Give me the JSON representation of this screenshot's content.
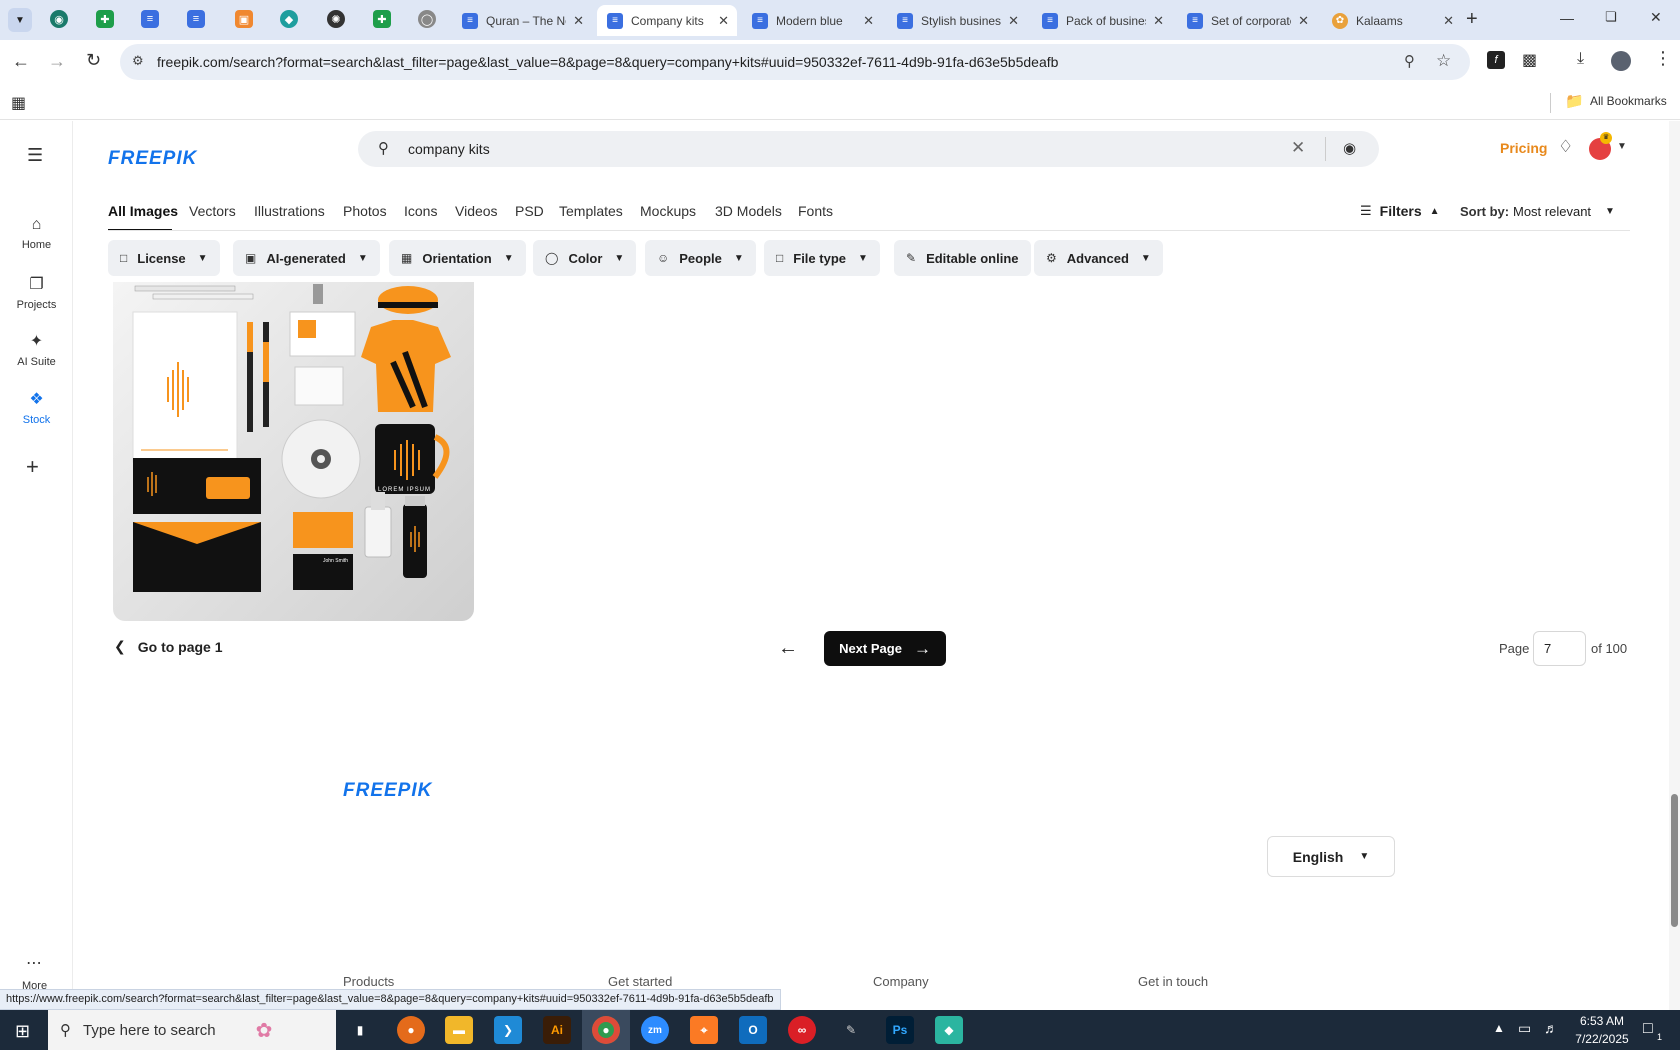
{
  "browser": {
    "tabs": [
      {
        "title": "Quran – The Noble",
        "active": false
      },
      {
        "title": "Company kits",
        "active": true
      },
      {
        "title": "Modern blue",
        "active": false
      },
      {
        "title": "Stylish business",
        "active": false
      },
      {
        "title": "Pack of business",
        "active": false
      },
      {
        "title": "Set of corporate",
        "active": false
      },
      {
        "title": "Kalaams",
        "active": false
      }
    ],
    "url": "freepik.com/search?format=search&last_filter=page&last_value=8&page=8&query=company+kits#uuid=950332ef-7611-4d9b-91fa-d63e5b5deafb",
    "bookmarks_label": "All Bookmarks",
    "status_url": "https://www.freepik.com/search?format=search&last_filter=page&last_value=8&page=8&query=company+kits#uuid=950332ef-7611-4d9b-91fa-d63e5b5deafb"
  },
  "rail": {
    "items": [
      {
        "label": "Home",
        "icon": "home-icon"
      },
      {
        "label": "Projects",
        "icon": "folder-icon"
      },
      {
        "label": "AI Suite",
        "icon": "sparkle-icon"
      },
      {
        "label": "Stock",
        "icon": "stock-icon"
      }
    ],
    "more": "More"
  },
  "header": {
    "logo": "FREEPIK",
    "search_value": "company kits",
    "pricing": "Pricing"
  },
  "nav": {
    "tabs": [
      "All Images",
      "Vectors",
      "Illustrations",
      "Photos",
      "Icons",
      "Videos",
      "PSD",
      "Templates",
      "Mockups",
      "3D Models",
      "Fonts"
    ],
    "filters": "Filters",
    "sort_label": "Sort by:",
    "sort_value": "Most relevant"
  },
  "chips": [
    "License",
    "AI-generated",
    "Orientation",
    "Color",
    "People",
    "File type",
    "Editable online",
    "Advanced"
  ],
  "mockup": {
    "lorem": "LOREM IPSUM",
    "card_name": "John Smith"
  },
  "pagination": {
    "go_first": "Go to page 1",
    "next": "Next Page",
    "page_label": "Page",
    "page_value": "7",
    "of_label": "of 100"
  },
  "footer": {
    "logo": "FREEPIK",
    "language": "English",
    "columns": [
      "Products",
      "Get started",
      "Company",
      "Get in touch"
    ]
  },
  "taskbar": {
    "search_placeholder": "Type here to search",
    "time": "6:53 AM",
    "date": "7/22/2025",
    "notif_count": "1"
  },
  "colors": {
    "brand_blue": "#1273eb",
    "orange": "#f7941d",
    "pricing": "#e8891c"
  }
}
